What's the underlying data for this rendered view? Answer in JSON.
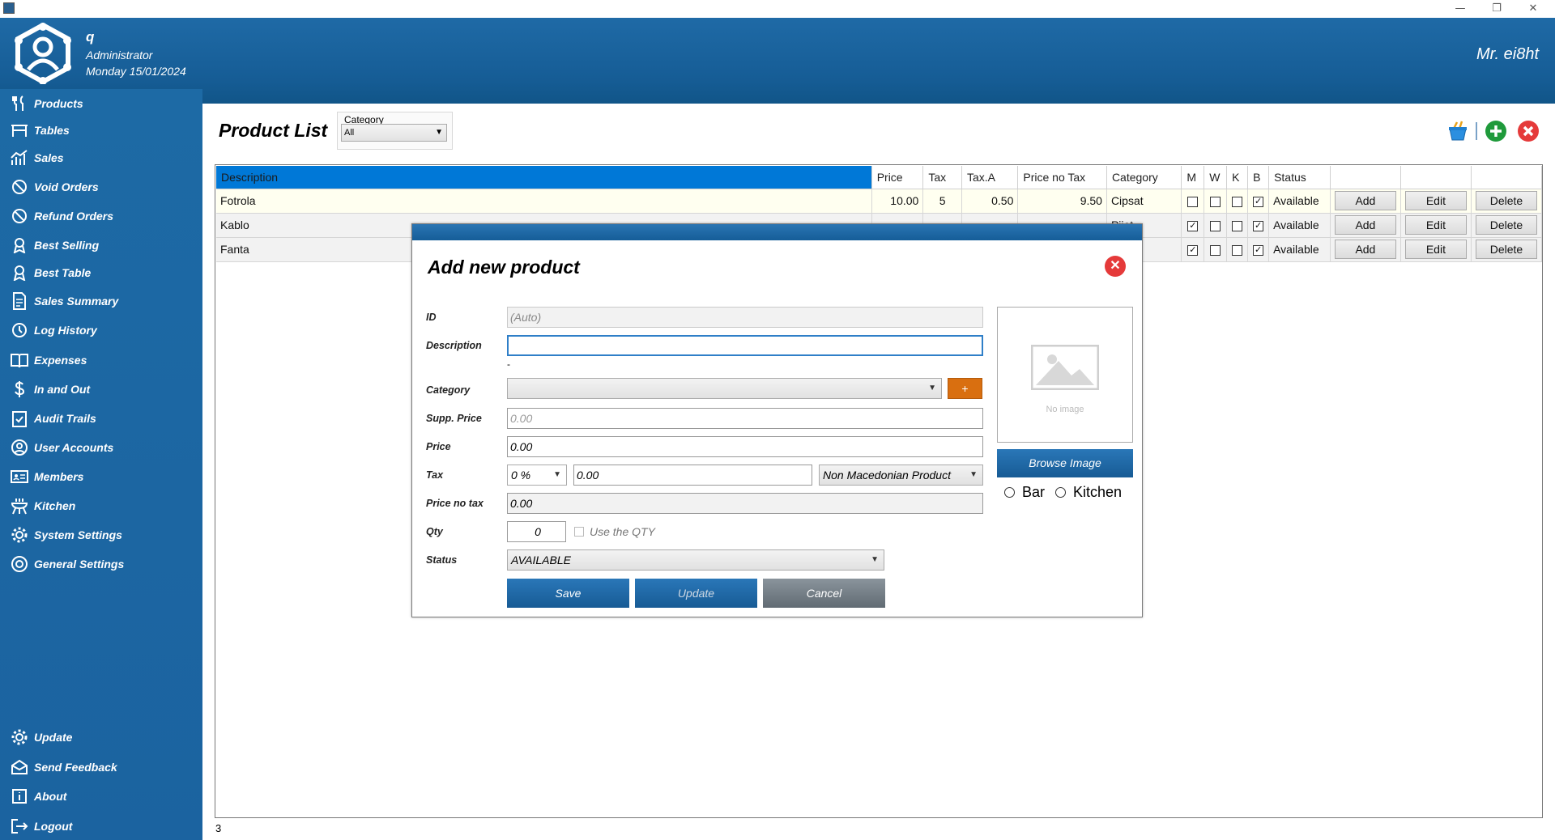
{
  "window": {
    "minimize": "—",
    "restore": "❐",
    "close": "✕"
  },
  "header": {
    "user_name": "q",
    "user_role": "Administrator",
    "date": "Monday 15/01/2024",
    "brand": "Mr. ei8ht"
  },
  "sidebar": {
    "items": [
      {
        "label": "Products",
        "icon": "fork-knife-icon"
      },
      {
        "label": "Tables",
        "icon": "table-icon"
      },
      {
        "label": "Sales",
        "icon": "chart-icon"
      },
      {
        "label": "Void Orders",
        "icon": "ban-icon"
      },
      {
        "label": "Refund Orders",
        "icon": "ban-icon"
      },
      {
        "label": "Best Selling",
        "icon": "award-icon"
      },
      {
        "label": "Best Table",
        "icon": "award-icon"
      },
      {
        "label": "Sales Summary",
        "icon": "document-icon"
      },
      {
        "label": "Log History",
        "icon": "clock-icon"
      },
      {
        "label": "Expenses",
        "icon": "book-icon"
      },
      {
        "label": "In and Out",
        "icon": "dollar-icon"
      },
      {
        "label": "Audit Trails",
        "icon": "clipboard-check-icon"
      },
      {
        "label": "User Accounts",
        "icon": "user-circle-icon"
      },
      {
        "label": "Members",
        "icon": "id-card-icon"
      },
      {
        "label": "Kitchen",
        "icon": "grill-icon"
      },
      {
        "label": "System Settings",
        "icon": "gear-icon"
      },
      {
        "label": "General Settings",
        "icon": "gear-circle-icon"
      }
    ],
    "bottom_items": [
      {
        "label": "Update",
        "icon": "gear-refresh-icon"
      },
      {
        "label": "Send Feedback",
        "icon": "mail-icon"
      },
      {
        "label": "About",
        "icon": "info-icon"
      },
      {
        "label": "Logout",
        "icon": "logout-icon"
      }
    ]
  },
  "page": {
    "title": "Product List",
    "category_label": "Category",
    "category_value": "All",
    "row_count": "3"
  },
  "grid": {
    "headers": [
      "Description",
      "Price",
      "Tax",
      "Tax.A",
      "Price no Tax",
      "Category",
      "M",
      "W",
      "K",
      "B",
      "Status",
      "",
      "",
      ""
    ],
    "rows": [
      {
        "description": "Fotrola",
        "price": "10.00",
        "tax": "5",
        "tax_a": "0.50",
        "price_no_tax": "9.50",
        "category": "Cipsat",
        "m": false,
        "w": false,
        "k": false,
        "b": true,
        "status": "Available",
        "add": "Add",
        "edit": "Edit",
        "delete": "Delete"
      },
      {
        "description": "Kablo",
        "price": "",
        "tax": "",
        "tax_a": "",
        "price_no_tax": "",
        "category": "Pijet",
        "m": true,
        "w": false,
        "k": false,
        "b": true,
        "status": "Available",
        "add": "Add",
        "edit": "Edit",
        "delete": "Delete"
      },
      {
        "description": "Fanta",
        "price": "",
        "tax": "",
        "tax_a": "",
        "price_no_tax": "",
        "category": "Pijet",
        "m": true,
        "w": false,
        "k": false,
        "b": true,
        "status": "Available",
        "add": "Add",
        "edit": "Edit",
        "delete": "Delete"
      }
    ]
  },
  "modal": {
    "title": "Add new product",
    "labels": {
      "id": "ID",
      "description": "Description",
      "category": "Category",
      "supp_price": "Supp. Price",
      "price": "Price",
      "tax": "Tax",
      "price_no_tax": "Price no tax",
      "qty": "Qty",
      "status": "Status"
    },
    "values": {
      "id": "(Auto)",
      "description": "",
      "description_hint": "-",
      "category": "",
      "supp_price_placeholder": "0.00",
      "price": "0.00",
      "tax_percent": "0 %",
      "tax_amount": "0.00",
      "tax_type": "Non Macedonian Product",
      "price_no_tax": "0.00",
      "qty": "0",
      "use_qty_label": "Use the QTY",
      "status": "AVAILABLE"
    },
    "plus_label": "+",
    "buttons": {
      "save": "Save",
      "update": "Update",
      "cancel": "Cancel"
    },
    "image": {
      "no_image": "No image",
      "browse": "Browse Image"
    },
    "radios": {
      "bar": "Bar",
      "kitchen": "Kitchen"
    }
  },
  "colors": {
    "accent": "#1b63a0",
    "dialog_close": "#e53a3a",
    "add": "#1f9a3b",
    "orange": "#d96f10"
  }
}
